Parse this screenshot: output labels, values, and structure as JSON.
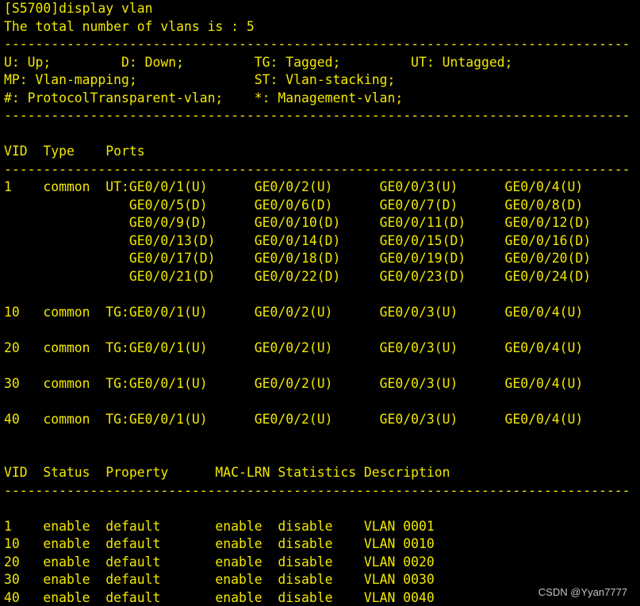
{
  "terminal": {
    "text_color": "#f2e800",
    "background_color": "#000000",
    "lines": [
      "[S5700]display vlan",
      "The total number of vlans is : 5",
      "--------------------------------------------------------------------------------",
      "U: Up;         D: Down;         TG: Tagged;         UT: Untagged;",
      "MP: Vlan-mapping;               ST: Vlan-stacking;",
      "#: ProtocolTransparent-vlan;    *: Management-vlan;",
      "--------------------------------------------------------------------------------",
      "",
      "VID  Type    Ports",
      "--------------------------------------------------------------------------------",
      "1    common  UT:GE0/0/1(U)      GE0/0/2(U)      GE0/0/3(U)      GE0/0/4(U)",
      "                GE0/0/5(D)      GE0/0/6(D)      GE0/0/7(D)      GE0/0/8(D)",
      "                GE0/0/9(D)      GE0/0/10(D)     GE0/0/11(D)     GE0/0/12(D)",
      "                GE0/0/13(D)     GE0/0/14(D)     GE0/0/15(D)     GE0/0/16(D)",
      "                GE0/0/17(D)     GE0/0/18(D)     GE0/0/19(D)     GE0/0/20(D)",
      "                GE0/0/21(D)     GE0/0/22(D)     GE0/0/23(D)     GE0/0/24(D)",
      "",
      "10   common  TG:GE0/0/1(U)      GE0/0/2(U)      GE0/0/3(U)      GE0/0/4(U)",
      "",
      "20   common  TG:GE0/0/1(U)      GE0/0/2(U)      GE0/0/3(U)      GE0/0/4(U)",
      "",
      "30   common  TG:GE0/0/1(U)      GE0/0/2(U)      GE0/0/3(U)      GE0/0/4(U)",
      "",
      "40   common  TG:GE0/0/1(U)      GE0/0/2(U)      GE0/0/3(U)      GE0/0/4(U)",
      "",
      "",
      "VID  Status  Property      MAC-LRN Statistics Description",
      "--------------------------------------------------------------------------------",
      "",
      "1    enable  default       enable  disable    VLAN 0001",
      "10   enable  default       enable  disable    VLAN 0010",
      "20   enable  default       enable  disable    VLAN 0020",
      "30   enable  default       enable  disable    VLAN 0030",
      "40   enable  default       enable  disable    VLAN 0040"
    ]
  },
  "watermark": "CSDN @Yyan7777"
}
